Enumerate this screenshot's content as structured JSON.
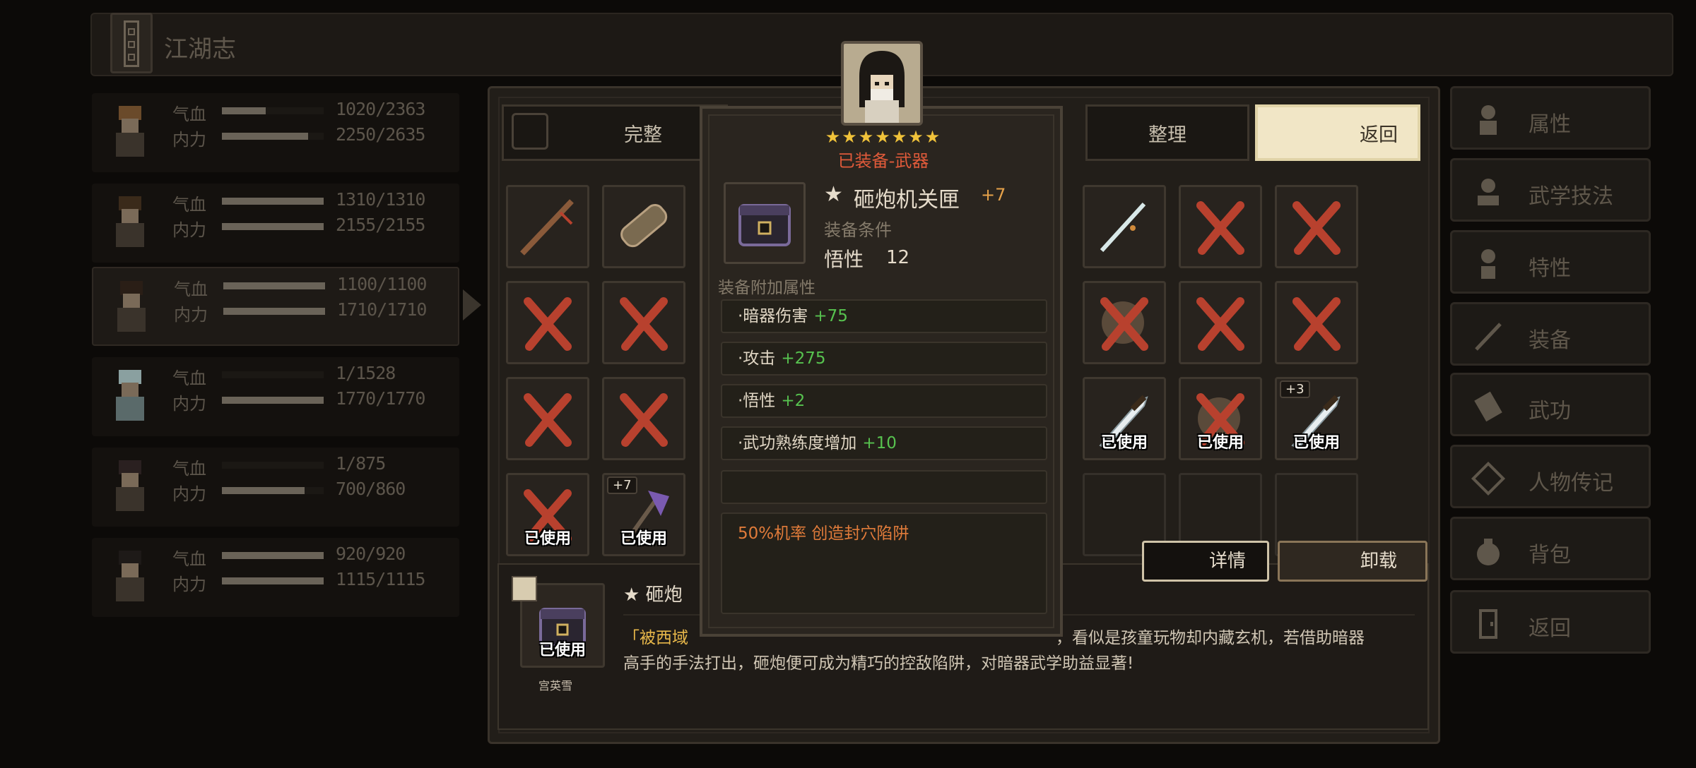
{
  "header": {
    "title": "江湖志"
  },
  "characters": [
    {
      "hp_label": "气血",
      "mp_label": "内力",
      "hp": "1020/2363",
      "mp": "2250/2635",
      "hp_ratio": 0.43,
      "mp_ratio": 0.85
    },
    {
      "hp_label": "气血",
      "mp_label": "内力",
      "hp": "1310/1310",
      "mp": "2155/2155",
      "hp_ratio": 1.0,
      "mp_ratio": 1.0
    },
    {
      "hp_label": "气血",
      "mp_label": "内力",
      "hp": "1100/1100",
      "mp": "1710/1710",
      "hp_ratio": 1.0,
      "mp_ratio": 1.0
    },
    {
      "hp_label": "气血",
      "mp_label": "内力",
      "hp": "1/1528",
      "mp": "1770/1770",
      "hp_ratio": 0.0,
      "mp_ratio": 1.0
    },
    {
      "hp_label": "气血",
      "mp_label": "内力",
      "hp": "1/875",
      "mp": "700/860",
      "hp_ratio": 0.0,
      "mp_ratio": 0.81
    },
    {
      "hp_label": "气血",
      "mp_label": "内力",
      "hp": "920/920",
      "mp": "1115/1115",
      "hp_ratio": 1.0,
      "mp_ratio": 1.0
    }
  ],
  "toolbar": {
    "complete_label": "完整",
    "sort_label": "整理",
    "return_label": "返回"
  },
  "inventory": {
    "used_label": "已使用",
    "left_plus_tag": "+7",
    "right_plus_tag": "+3"
  },
  "tooltip": {
    "stars": "★★★★★★★",
    "equipped": "已装备-武器",
    "name_star": "★",
    "name": "砸炮机关匣",
    "plus": "+7",
    "condition_label": "装备条件",
    "condition_name": "悟性",
    "condition_value": "12",
    "attr_label": "装备附加属性",
    "attrs": [
      {
        "name": "·暗器伤害",
        "value": "+75"
      },
      {
        "name": "·攻击",
        "value": "+275"
      },
      {
        "name": "·悟性",
        "value": "+2"
      },
      {
        "name": "·武功熟练度增加",
        "value": "+10"
      }
    ],
    "effect": "50%机率 创造封穴陷阱"
  },
  "actions": {
    "detail_label": "详情",
    "unload_label": "卸载"
  },
  "description": {
    "title": "★ 砸炮",
    "line1_quote": "「被西域",
    "line1_rest": "，看似是孩童玩物却内藏玄机，若借助暗器",
    "line2": "高手的手法打出，砸炮便可成为精巧的控敌陷阱，对暗器武学助益显著!",
    "used_label": "已使用",
    "owner": "宫英雪"
  },
  "menu": [
    {
      "label": "属性",
      "icon": "person-icon"
    },
    {
      "label": "武学技法",
      "icon": "meditation-icon"
    },
    {
      "label": "特性",
      "icon": "trait-icon"
    },
    {
      "label": "装备",
      "icon": "sword-icon"
    },
    {
      "label": "武功",
      "icon": "manual-icon"
    },
    {
      "label": "人物传记",
      "icon": "scroll-icon"
    },
    {
      "label": "背包",
      "icon": "bag-icon"
    },
    {
      "label": "返回",
      "icon": "door-icon"
    }
  ],
  "colors": {
    "accent": "#f1e6c6",
    "equipped_red": "#e05a3a",
    "bonus_green": "#57c24f",
    "effect_orange": "#e07b3a",
    "star_gold": "#f0c23a"
  }
}
